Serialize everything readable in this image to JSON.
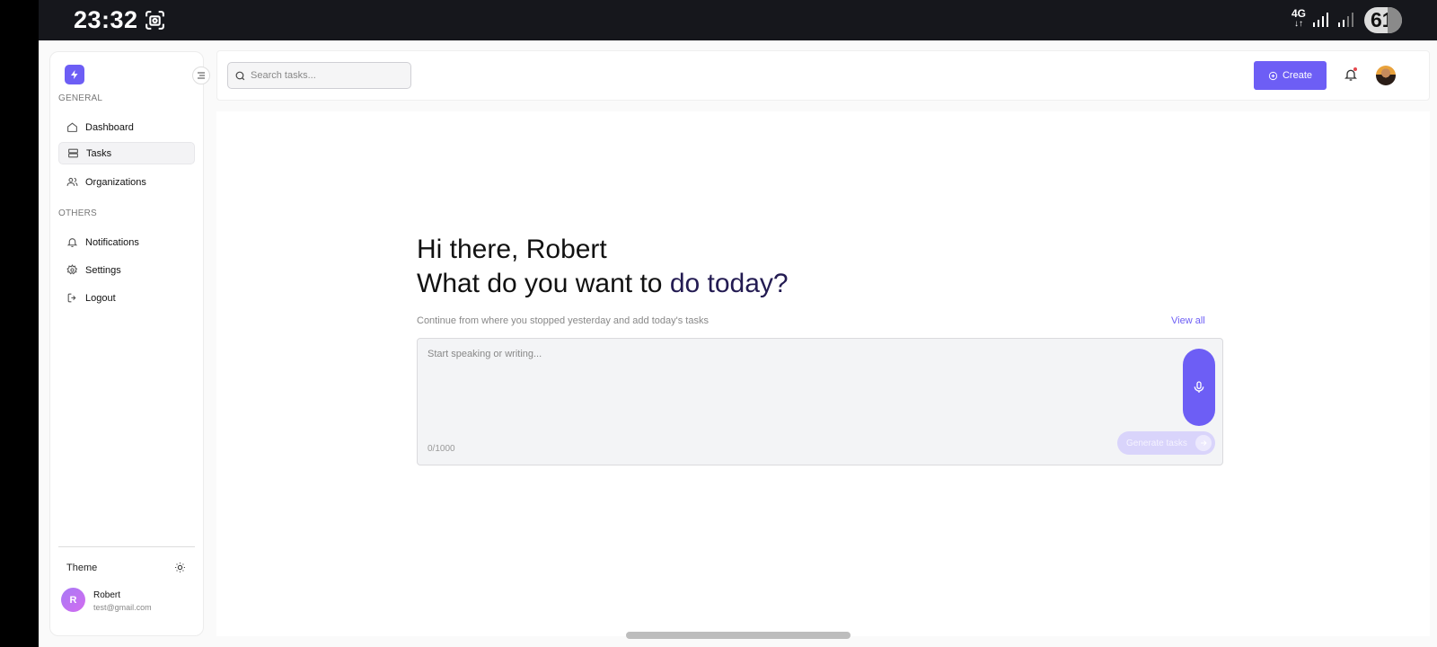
{
  "status_bar": {
    "time": "23:32",
    "network": "4G",
    "network_arrows": "↓↑",
    "battery": "61",
    "battery_level": 0.61
  },
  "sidebar": {
    "sections": [
      {
        "label": "GENERAL",
        "items": [
          {
            "label": "Dashboard",
            "icon": "home-icon"
          },
          {
            "label": "Tasks",
            "icon": "tasks-icon",
            "active": true
          },
          {
            "label": "Organizations",
            "icon": "users-icon"
          }
        ]
      },
      {
        "label": "OTHERS",
        "items": [
          {
            "label": "Notifications",
            "icon": "bell-icon"
          },
          {
            "label": "Settings",
            "icon": "gear-icon"
          },
          {
            "label": "Logout",
            "icon": "logout-icon"
          }
        ]
      }
    ],
    "theme_label": "Theme",
    "user": {
      "initial": "R",
      "name": "Robert",
      "email": "test@gmail.com"
    }
  },
  "topbar": {
    "search_placeholder": "Search tasks...",
    "search_value": "",
    "create_label": "Create"
  },
  "main": {
    "greeting": "Hi there, Robert",
    "question_part1": "What do you want to ",
    "question_part2": "do today?",
    "subtitle": "Continue from where you stopped yesterday and add today's tasks",
    "view_all": "View all",
    "composer": {
      "placeholder": "Start speaking or writing...",
      "value": "",
      "counter": "0/1000",
      "generate_label": "Generate tasks"
    }
  },
  "colors": {
    "accent": "#6d5ef5",
    "accent_disabled": "#d9d4fb",
    "status_bar_bg": "#16171c"
  }
}
